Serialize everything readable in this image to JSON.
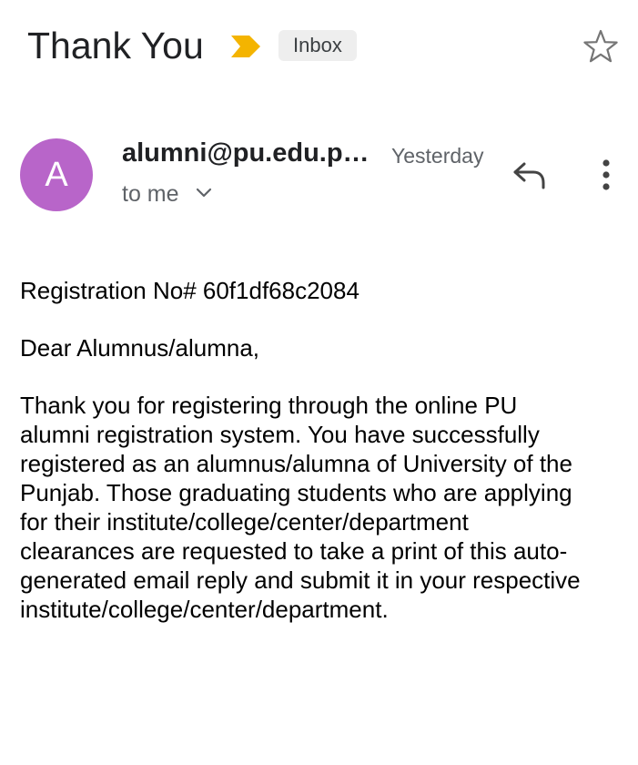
{
  "header": {
    "subject": "Thank You",
    "label": "Inbox",
    "importance_color": "#f4b400"
  },
  "message": {
    "avatar_letter": "A",
    "avatar_color": "#b865c9",
    "sender": "alumni@pu.edu.p…",
    "date": "Yesterday",
    "recipient": "to me"
  },
  "body": {
    "registration": "Registration No# 60f1df68c2084",
    "greeting": "Dear Alumnus/alumna,",
    "lines": [
      "Thank you for registering through the online PU",
      "alumni registration system. You have successfully",
      "registered as an alumnus/alumna of University of the",
      "Punjab. Those graduating students who are applying",
      "for their institute/college/center/department",
      "clearances are requested to take a print of this auto-",
      "generated email reply and submit it in your respective",
      "institute/college/center/department."
    ]
  },
  "icons": {
    "importance": "importance-marker-icon",
    "star": "star-outline-icon",
    "reply": "reply-icon",
    "more": "more-vert-icon",
    "recipient_details": "chevron-down-icon"
  }
}
